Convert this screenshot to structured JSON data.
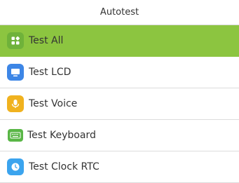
{
  "header": {
    "title": "Autotest"
  },
  "menu": {
    "items": [
      {
        "label": "Test All",
        "icon": "grid-icon",
        "selected": true,
        "icon_color": "#6fb23a"
      },
      {
        "label": "Test LCD",
        "icon": "monitor-icon",
        "selected": false,
        "icon_color": "#3d86e6"
      },
      {
        "label": "Test Voice",
        "icon": "microphone-icon",
        "selected": false,
        "icon_color": "#f0b21f"
      },
      {
        "label": "Test Keyboard",
        "icon": "keyboard-icon",
        "selected": false,
        "icon_color": "#59b646"
      },
      {
        "label": "Test Clock RTC",
        "icon": "clock-icon",
        "selected": false,
        "icon_color": "#3ba4ee"
      }
    ]
  },
  "colors": {
    "selected_bg": "#8cc540",
    "divider": "#dcdcdc"
  }
}
